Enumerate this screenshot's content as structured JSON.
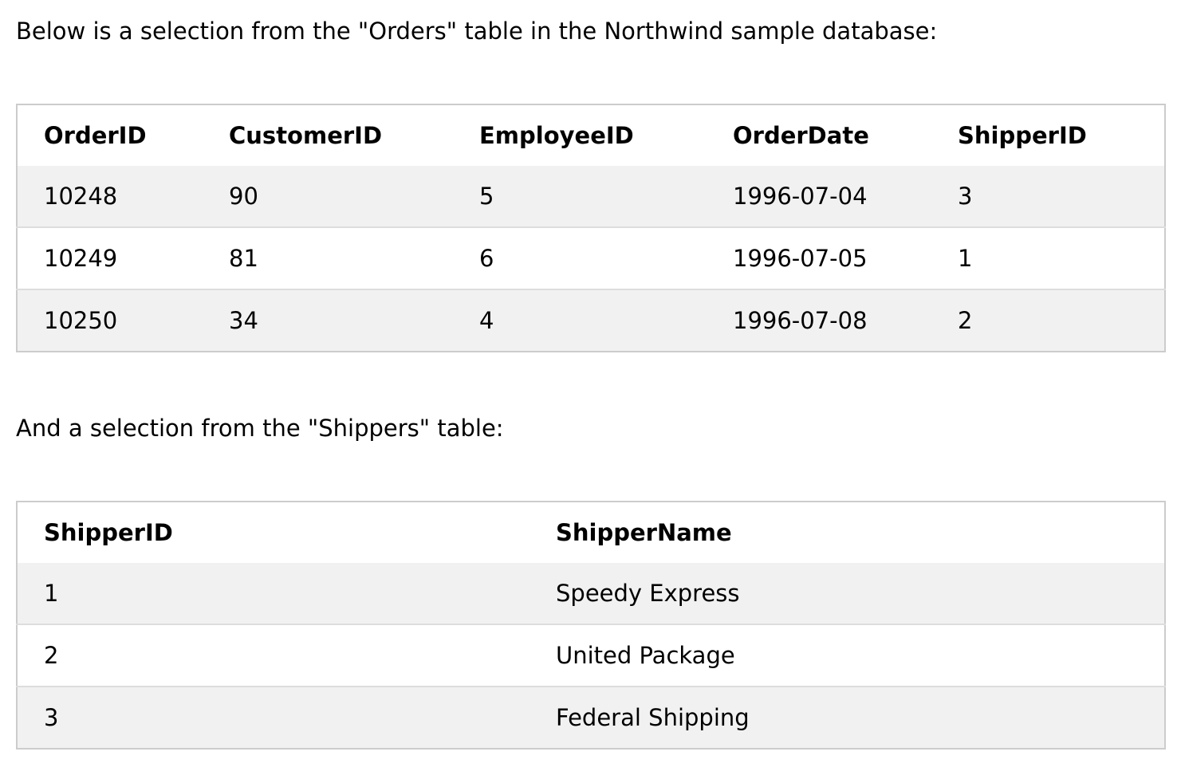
{
  "intro_orders": "Below is a selection from the \"Orders\" table in the Northwind sample database:",
  "orders": {
    "headers": [
      "OrderID",
      "CustomerID",
      "EmployeeID",
      "OrderDate",
      "ShipperID"
    ],
    "rows": [
      [
        "10248",
        "90",
        "5",
        "1996-07-04",
        "3"
      ],
      [
        "10249",
        "81",
        "6",
        "1996-07-05",
        "1"
      ],
      [
        "10250",
        "34",
        "4",
        "1996-07-08",
        "2"
      ]
    ]
  },
  "intro_shippers": "And a selection from the \"Shippers\" table:",
  "shippers": {
    "headers": [
      "ShipperID",
      "ShipperName"
    ],
    "rows": [
      [
        "1",
        "Speedy Express"
      ],
      [
        "2",
        "United Package"
      ],
      [
        "3",
        "Federal Shipping"
      ]
    ]
  }
}
